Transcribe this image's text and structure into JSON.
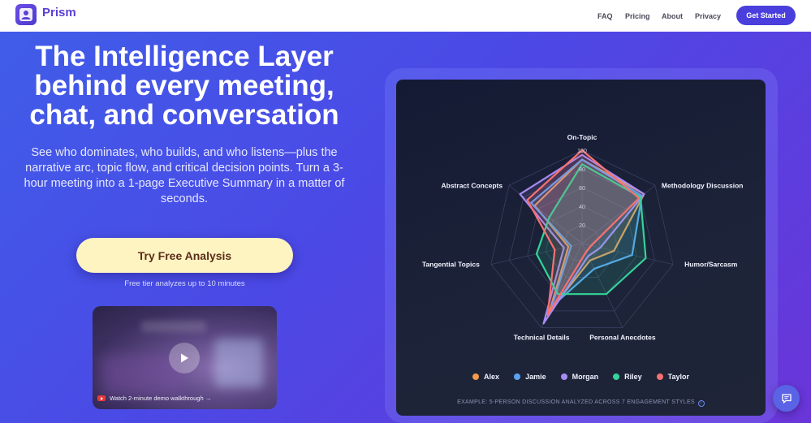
{
  "header": {
    "brand": "Prism",
    "nav": [
      "FAQ",
      "Pricing",
      "About",
      "Privacy"
    ],
    "cta": "Get Started"
  },
  "hero": {
    "title_lines": [
      "The Intelligence Layer",
      "behind every meeting,",
      "chat, and conversation"
    ],
    "subtitle": "See who dominates, who builds, and who listens—plus the narrative arc, topic flow, and critical decision points. Turn a 3-hour meeting into a 1-page Executive Summary in a matter of seconds.",
    "try_button": "Try Free Analysis",
    "free_note": "Free tier analyzes up to 10 minutes",
    "video_caption": "Watch 2-minute demo walkthrough →"
  },
  "chart_data": {
    "type": "radar",
    "axes": [
      "On-Topic",
      "Methodology Discussion",
      "Humor/Sarcasm",
      "Personal Anecdotes",
      "Technical Details",
      "Tangential Topics",
      "Abstract Concepts"
    ],
    "ticks": [
      20,
      40,
      60,
      80,
      100
    ],
    "range": [
      0,
      100
    ],
    "series": [
      {
        "name": "Alex",
        "color": "#f59a4a",
        "values": [
          90,
          85,
          35,
          20,
          80,
          15,
          65
        ]
      },
      {
        "name": "Jamie",
        "color": "#5aa3f0",
        "values": [
          90,
          82,
          55,
          30,
          75,
          12,
          70
        ]
      },
      {
        "name": "Morgan",
        "color": "#a78bf5",
        "values": [
          95,
          85,
          20,
          15,
          95,
          20,
          85
        ]
      },
      {
        "name": "Riley",
        "color": "#34d399",
        "values": [
          85,
          80,
          70,
          60,
          60,
          50,
          45
        ]
      },
      {
        "name": "Taylor",
        "color": "#f87171",
        "values": [
          100,
          78,
          10,
          10,
          85,
          30,
          75
        ]
      }
    ],
    "grid": true,
    "legend_position": "bottom"
  },
  "chart_footer": "EXAMPLE: 5-PERSON DISCUSSION ANALYZED ACROSS 7 ENGAGEMENT STYLES"
}
